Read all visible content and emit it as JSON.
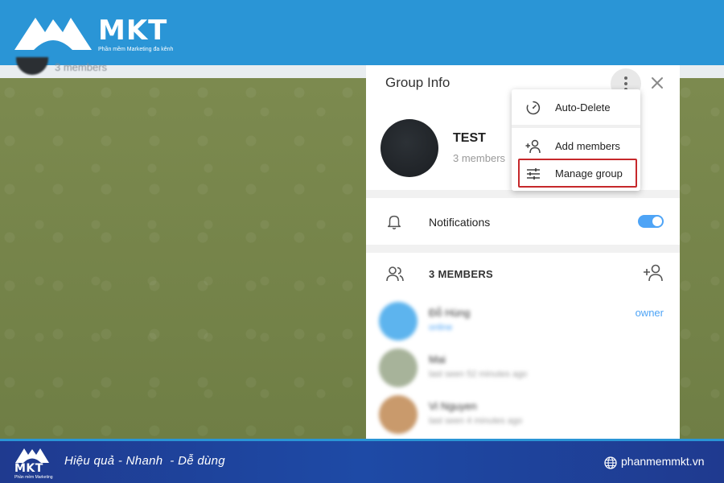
{
  "brand": {
    "logo_text": "MKT",
    "tagline": "Phần mềm Marketing đa kênh",
    "footer_tagline": "Phần mềm Marketing",
    "slogan": "Hiệu quả - Nhanh  - Dễ dùng",
    "website": "phanmemmkt.vn",
    "primary_color": "#2a95d6",
    "footer_color": "#1f3a8f"
  },
  "background_chat": {
    "members_text": "3 members"
  },
  "group_info": {
    "title": "Group Info",
    "group_name": "TEST",
    "member_count": "3 members",
    "notifications_label": "Notifications",
    "notifications_on": true,
    "members_header": "3 MEMBERS",
    "accent_color": "#4ea4f6",
    "members": [
      {
        "name": "Đỗ Hùng",
        "status": "online",
        "role": "owner",
        "avatar_color": "#5db4ee"
      },
      {
        "name": "Mai",
        "status": "last seen 52 minutes ago",
        "role": "",
        "avatar_color": "#a7b39a"
      },
      {
        "name": "Vi Nguyen",
        "status": "last seen 4 minutes ago",
        "role": "",
        "avatar_color": "#c99a6c"
      }
    ]
  },
  "menu": {
    "items": [
      {
        "label": "Auto-Delete",
        "icon": "timer-icon"
      },
      {
        "label": "Add members",
        "icon": "add-user-icon"
      },
      {
        "label": "Manage group",
        "icon": "sliders-icon"
      }
    ],
    "highlight_color": "#c6282b"
  }
}
